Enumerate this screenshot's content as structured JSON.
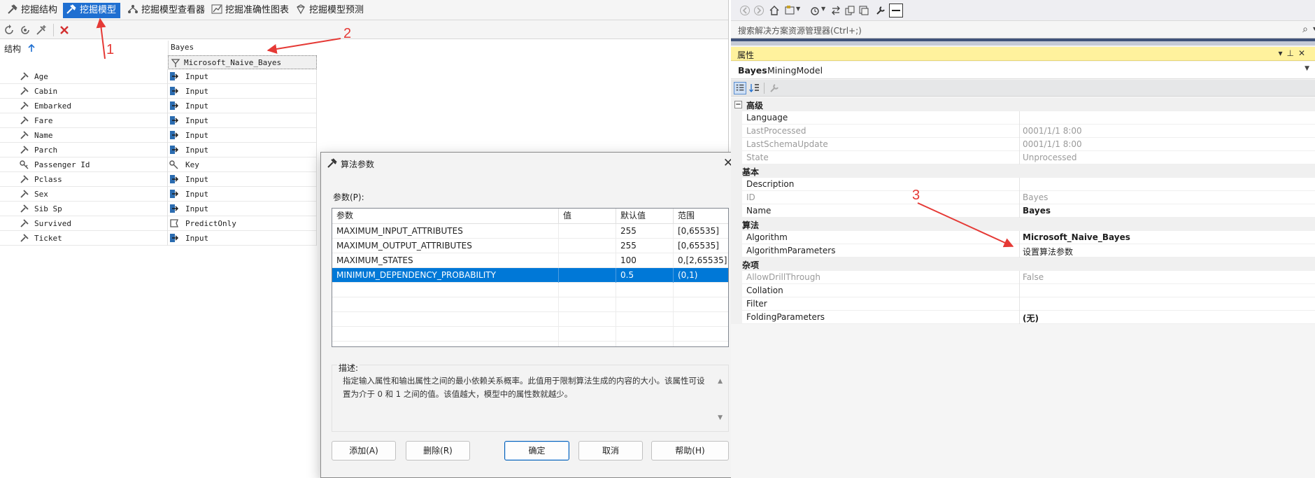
{
  "designer": {
    "tabs": [
      {
        "label": "挖掘结构",
        "active": false,
        "icon": "mining-structure-icon"
      },
      {
        "label": "挖掘模型",
        "active": true,
        "icon": "mining-model-icon"
      },
      {
        "label": "挖掘模型查看器",
        "active": false,
        "icon": "model-viewer-icon"
      },
      {
        "label": "挖掘准确性图表",
        "active": false,
        "icon": "accuracy-chart-icon"
      },
      {
        "label": "挖掘模型预测",
        "active": false,
        "icon": "prediction-icon"
      }
    ],
    "grid_header": {
      "structure_label": "结构",
      "model_name": "Bayes",
      "algorithm": "Microsoft_Naive_Bayes"
    },
    "rows": [
      {
        "column": "Age",
        "usage": "Input"
      },
      {
        "column": "Cabin",
        "usage": "Input"
      },
      {
        "column": "Embarked",
        "usage": "Input"
      },
      {
        "column": "Fare",
        "usage": "Input"
      },
      {
        "column": "Name",
        "usage": "Input"
      },
      {
        "column": "Parch",
        "usage": "Input"
      },
      {
        "column": "Passenger Id",
        "usage": "Key"
      },
      {
        "column": "Pclass",
        "usage": "Input"
      },
      {
        "column": "Sex",
        "usage": "Input"
      },
      {
        "column": "Sib Sp",
        "usage": "Input"
      },
      {
        "column": "Survived",
        "usage": "PredictOnly"
      },
      {
        "column": "Ticket",
        "usage": "Input"
      }
    ]
  },
  "dialog": {
    "title": "算法参数",
    "params_label": "参数(P):",
    "columns": [
      "参数",
      "值",
      "默认值",
      "范围"
    ],
    "params": [
      {
        "name": "MAXIMUM_INPUT_ATTRIBUTES",
        "value": "",
        "default": "255",
        "range": "[0,65535]",
        "selected": false
      },
      {
        "name": "MAXIMUM_OUTPUT_ATTRIBUTES",
        "value": "",
        "default": "255",
        "range": "[0,65535]",
        "selected": false
      },
      {
        "name": "MAXIMUM_STATES",
        "value": "",
        "default": "100",
        "range": "0,[2,65535]",
        "selected": false
      },
      {
        "name": "MINIMUM_DEPENDENCY_PROBABILITY",
        "value": "",
        "default": "0.5",
        "range": "(0,1)",
        "selected": true
      }
    ],
    "desc_label": "描述:",
    "description": "指定输入属性和输出属性之间的最小依赖关系概率。此值用于限制算法生成的内容的大小。该属性可设置为介于 0 和 1 之间的值。该值越大，模型中的属性数就越少。",
    "buttons": {
      "add": "添加(A)",
      "delete": "删除(R)",
      "ok": "确定",
      "cancel": "取消",
      "help": "帮助(H)"
    }
  },
  "solution": {
    "search_placeholder": "搜索解决方案资源管理器(Ctrl+;)"
  },
  "properties": {
    "title": "属性",
    "object_name": "Bayes",
    "object_type": "MiningModel",
    "rows": [
      {
        "kind": "category",
        "name": "高级"
      },
      {
        "kind": "item",
        "name": "Language",
        "value": "",
        "gray": false,
        "bold": false
      },
      {
        "kind": "item",
        "name": "LastProcessed",
        "value": "0001/1/1 8:00",
        "gray": true,
        "bold": false
      },
      {
        "kind": "item",
        "name": "LastSchemaUpdate",
        "value": "0001/1/1 8:00",
        "gray": true,
        "bold": false
      },
      {
        "kind": "item",
        "name": "State",
        "value": "Unprocessed",
        "gray": true,
        "bold": false
      },
      {
        "kind": "category",
        "name": "基本"
      },
      {
        "kind": "item",
        "name": "Description",
        "value": "",
        "gray": false,
        "bold": false
      },
      {
        "kind": "item",
        "name": "ID",
        "value": "Bayes",
        "gray": true,
        "bold": false
      },
      {
        "kind": "item",
        "name": "Name",
        "value": "Bayes",
        "gray": false,
        "bold": true
      },
      {
        "kind": "category",
        "name": "算法"
      },
      {
        "kind": "item",
        "name": "Algorithm",
        "value": "Microsoft_Naive_Bayes",
        "gray": false,
        "bold": true
      },
      {
        "kind": "item",
        "name": "AlgorithmParameters",
        "value": "设置算法参数",
        "gray": false,
        "bold": false
      },
      {
        "kind": "category",
        "name": "杂项"
      },
      {
        "kind": "item",
        "name": "AllowDrillThrough",
        "value": "False",
        "gray": true,
        "bold": false
      },
      {
        "kind": "item",
        "name": "Collation",
        "value": "",
        "gray": false,
        "bold": false
      },
      {
        "kind": "item",
        "name": "Filter",
        "value": "",
        "gray": false,
        "bold": false
      },
      {
        "kind": "item",
        "name": "FoldingParameters",
        "value": "(无)",
        "gray": false,
        "bold": true
      }
    ]
  },
  "annotations": {
    "labels": [
      "1",
      "2",
      "3"
    ],
    "color": "#e53935"
  }
}
